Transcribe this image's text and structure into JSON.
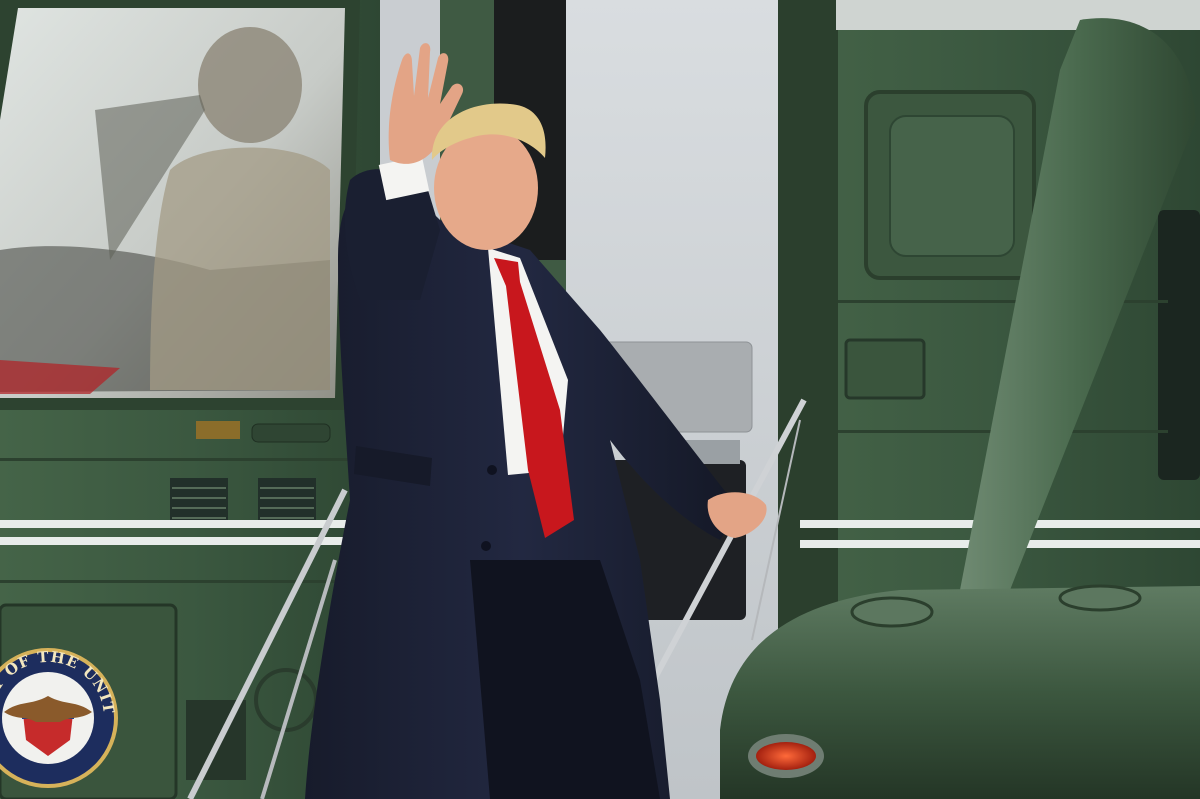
{
  "seal": {
    "arc_text": "ENT OF THE UNITED"
  },
  "colors": {
    "helicopter_green": "#3e5a40",
    "helicopter_dark": "#2b3f2d",
    "stripe_white": "#e8ecea",
    "coat_navy": "#1c2133",
    "tie_red": "#c8171d",
    "hair_blond": "#e2c98a",
    "skin": "#e6a98a",
    "doorway_gray": "#cfd3d6"
  }
}
